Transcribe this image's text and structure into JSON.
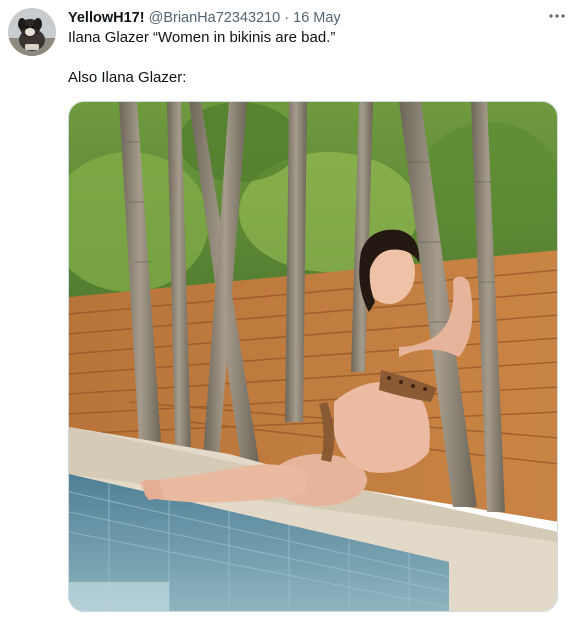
{
  "tweet": {
    "author_name": "YellowH17!",
    "author_handle": "@BrianHa72343210",
    "separator": "·",
    "date": "16 May",
    "text_line_1": "Ilana Glazer “Women in bikinis are bad.”",
    "text_line_2": "Also Ilana Glazer:"
  },
  "icons": {
    "avatar": "dog-avatar",
    "more": "more-horizontal-icon"
  }
}
